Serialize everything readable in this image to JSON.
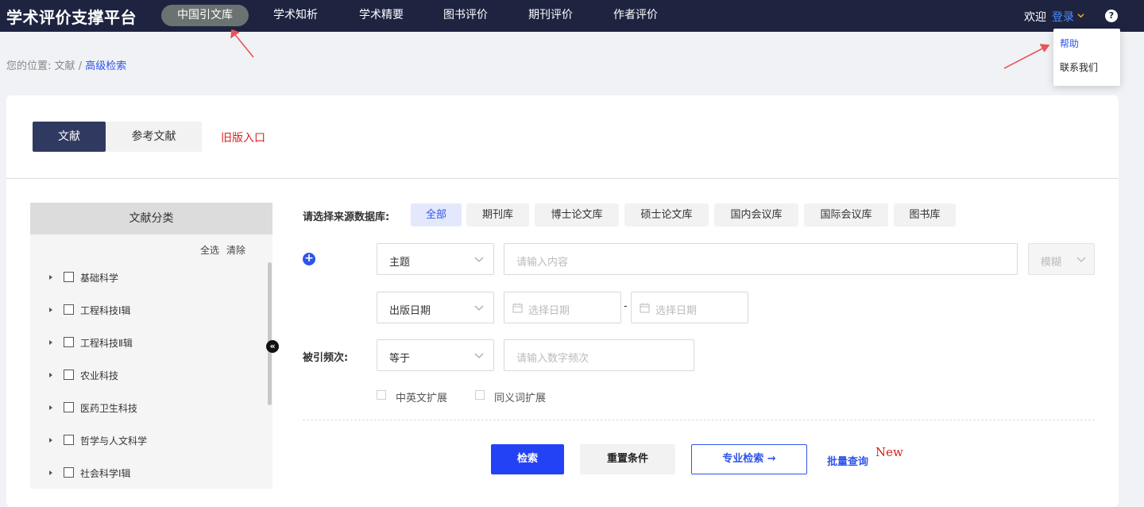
{
  "header": {
    "brand": "学术评价支撑平台",
    "nav": [
      {
        "label": "中国引文库",
        "active": true
      },
      {
        "label": "学术知析",
        "active": false
      },
      {
        "label": "学术精要",
        "active": false
      },
      {
        "label": "图书评价",
        "active": false
      },
      {
        "label": "期刊评价",
        "active": false
      },
      {
        "label": "作者评价",
        "active": false
      }
    ],
    "welcome": "欢迎",
    "login": "登录",
    "help_icon": "question-icon"
  },
  "help_menu": {
    "items": [
      "帮助",
      "联系我们"
    ]
  },
  "breadcrumb": {
    "prefix": "您的位置:",
    "parent": "文献",
    "separator": "/",
    "current": "高级检索"
  },
  "tabs": {
    "literature": "文献",
    "references": "参考文献",
    "old_entry": "旧版入口"
  },
  "categories": {
    "title": "文献分类",
    "select_all": "全选",
    "clear": "清除",
    "items": [
      "基础科学",
      "工程科技Ⅰ辑",
      "工程科技Ⅱ辑",
      "农业科技",
      "医药卫生科技",
      "哲学与人文科学",
      "社会科学Ⅰ辑"
    ]
  },
  "search": {
    "source_label": "请选择来源数据库:",
    "sources": [
      {
        "label": "全部",
        "active": true
      },
      {
        "label": "期刊库",
        "active": false
      },
      {
        "label": "博士论文库",
        "active": false
      },
      {
        "label": "硕士论文库",
        "active": false
      },
      {
        "label": "国内会议库",
        "active": false
      },
      {
        "label": "国际会议库",
        "active": false
      },
      {
        "label": "图书库",
        "active": false
      }
    ],
    "field_select": "主题",
    "content_placeholder": "请输入内容",
    "match_mode": "模糊",
    "date_select": "出版日期",
    "date_start_placeholder": "选择日期",
    "date_separator": "-",
    "date_end_placeholder": "选择日期",
    "freq_label": "被引频次:",
    "freq_op": "等于",
    "freq_placeholder": "请输入数字频次",
    "options": [
      "中英文扩展",
      "同义词扩展"
    ]
  },
  "actions": {
    "search": "检索",
    "reset": "重置条件",
    "professional": "专业检索 →",
    "batch": "批量查询",
    "new_badge": "New"
  },
  "colors": {
    "topbar": "#1e2440",
    "accent": "#2f54eb",
    "primary_button": "#2442f5",
    "annotation_arrow": "#e8545a"
  }
}
